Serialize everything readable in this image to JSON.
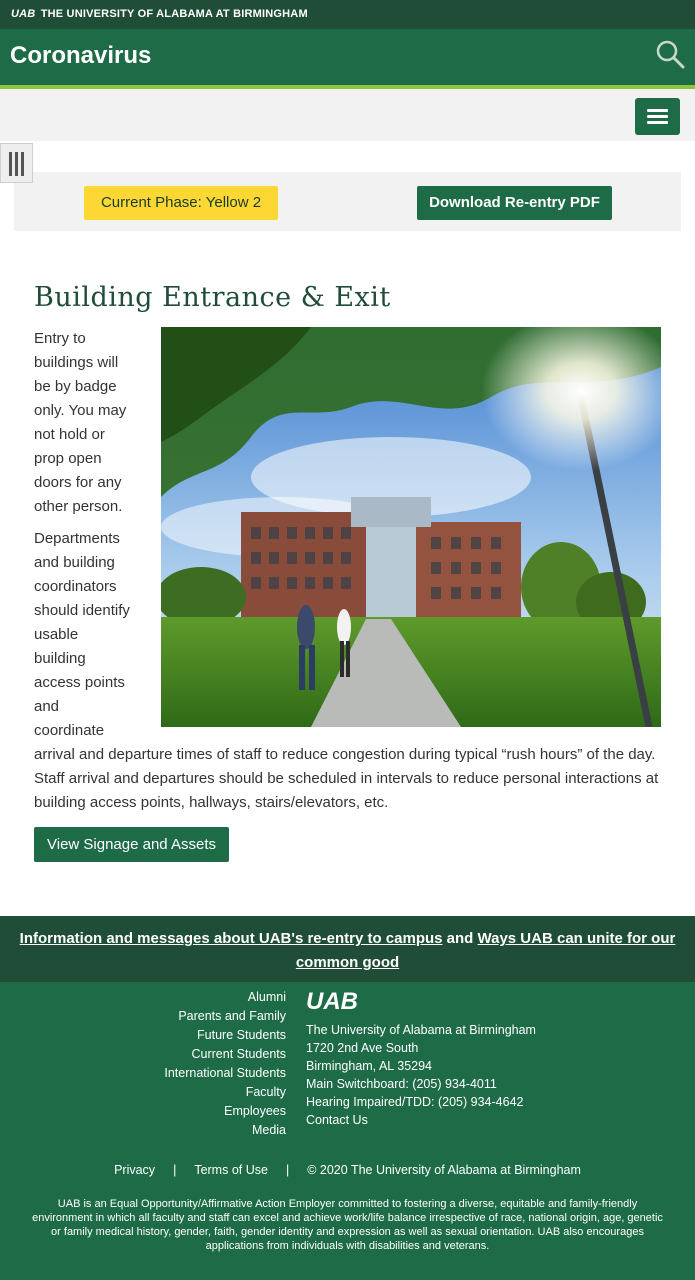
{
  "topbar": {
    "brand_mark": "UAB",
    "brand_text": "THE UNIVERSITY OF ALABAMA AT BIRMINGHAM"
  },
  "header": {
    "site_title": "Coronavirus",
    "search_icon": "search-icon",
    "menu_icon": "hamburger-menu-icon"
  },
  "phase": {
    "current_phase": "Current Phase: Yellow 2",
    "download_label": "Download Re-entry PDF"
  },
  "article": {
    "heading": "Building Entrance & Exit",
    "paragraph_1": "Entry to buildings will be by badge only. You may not hold or prop open doors for any other person.",
    "paragraph_2": "Departments and building coordinators should identify usable building access points and coordinate arrival and departure times of staff to reduce congestion during typical “rush hours” of the day. Staff arrival and departures should be scheduled in intervals to reduce personal interactions at building access points, hallways, stairs/elevators, etc.",
    "cta_label": "View Signage and Assets"
  },
  "footer_banner": {
    "link_1": "Information and messages about UAB's re-entry to campus",
    "connector": " and ",
    "link_2": "Ways UAB can unite for our common good"
  },
  "footer": {
    "links": [
      "Alumni",
      "Parents and Family",
      "Future Students",
      "Current Students",
      "International Students",
      "Faculty",
      "Employees",
      "Media"
    ],
    "logo_text": "UAB",
    "university": "The University of Alabama at Birmingham",
    "address": "1720 2nd Ave South",
    "city": "Birmingham, AL 35294",
    "switchboard": "Main Switchboard: (205) 934-4011",
    "tdd": "Hearing Impaired/TDD: (205) 934-4642",
    "contact": "Contact Us",
    "privacy": "Privacy",
    "terms": "Terms of Use",
    "copyright": "© 2020 The University of Alabama at Birmingham",
    "separator": "|",
    "eoe": "UAB is an Equal Opportunity/Affirmative Action Employer committed to fostering a diverse, equitable and family-friendly environment in which all faculty and staff can excel and achieve work/life balance irrespective of race, national origin, age, genetic or family medical history, gender, faith, gender identity and expression as well as sexual orientation. UAB also encourages applications from individuals with disabilities and veterans."
  },
  "colors": {
    "dark_green": "#1f4d37",
    "green": "#1e6b47",
    "lime": "#8cc63f",
    "yellow": "#fdd835"
  }
}
